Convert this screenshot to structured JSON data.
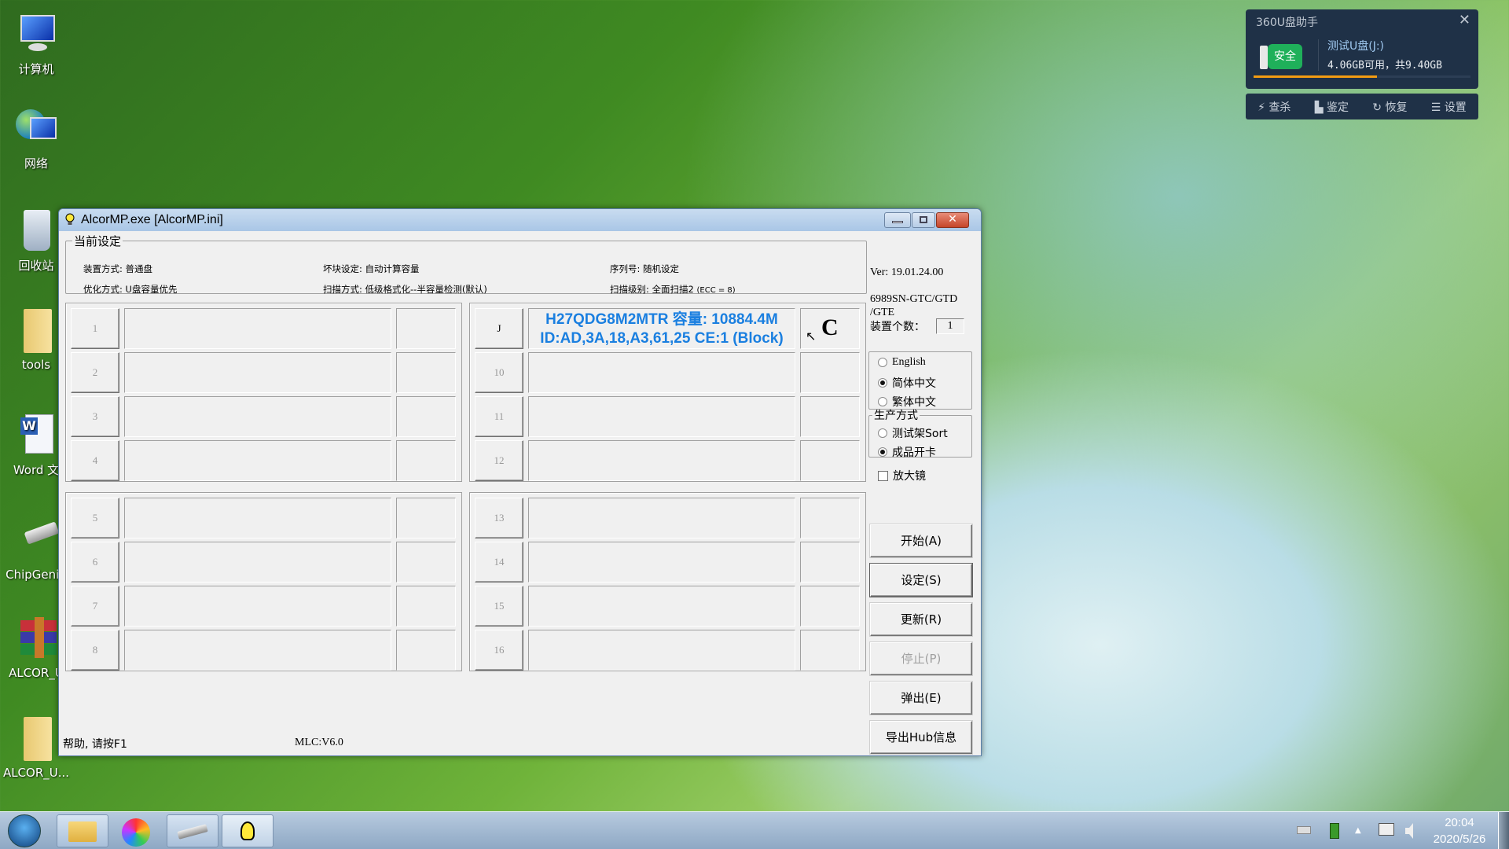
{
  "desktop": {
    "icons": [
      {
        "name": "computer",
        "label": "计算机"
      },
      {
        "name": "network",
        "label": "网络"
      },
      {
        "name": "recycle-bin",
        "label": "回收站"
      },
      {
        "name": "tools-folder",
        "label": "tools"
      },
      {
        "name": "word-document",
        "label": "Word 文"
      },
      {
        "name": "chipgenius",
        "label": "ChipGeniu"
      },
      {
        "name": "alcor-archive",
        "label": "ALCOR_U"
      },
      {
        "name": "alcor-folder",
        "label": "ALCOR_U..."
      }
    ]
  },
  "window": {
    "title": "AlcorMP.exe [AlcorMP.ini]",
    "settings": {
      "legend": "当前设定",
      "mount_mode": "装置方式: 普通盘",
      "optimize_mode": "优化方式: U盘容量优先",
      "bad_block": "坏块设定: 自动计算容量",
      "scan_mode": "扫描方式: 低级格式化--半容量检测(默认)",
      "serial": "序列号: 随机设定",
      "scan_level": "扫描级别: 全面扫描2",
      "scan_level_ecc": "(ECC = 8)"
    },
    "version": "Ver: 19.01.24.00",
    "chip": "6989SN-GTC/GTD /GTE",
    "device_count_label": "装置个数：",
    "device_count": "1",
    "ports_left_top": [
      "1",
      "2",
      "3",
      "4"
    ],
    "ports_left_bottom": [
      "5",
      "6",
      "7",
      "8"
    ],
    "ports_right_top": [
      "J",
      "10",
      "11",
      "12"
    ],
    "ports_right_bottom": [
      "13",
      "14",
      "15",
      "16"
    ],
    "active_port": {
      "line1": "H27QDG8M2MTR 容量: 10884.4M",
      "line2": "ID:AD,3A,18,A3,61,25 CE:1 (Block)",
      "status": "C"
    },
    "language": {
      "options": [
        "English",
        "简体中文",
        "繁体中文"
      ],
      "selected": "简体中文"
    },
    "production": {
      "legend": "生产方式",
      "options": [
        "测试架Sort",
        "成品开卡"
      ],
      "selected": "成品开卡"
    },
    "magnifier_label": "放大镜",
    "magnifier_checked": false,
    "buttons": {
      "start": "开始(A)",
      "settings": "设定(S)",
      "refresh": "更新(R)",
      "stop": "停止(P)",
      "eject": "弹出(E)",
      "export_hub": "导出Hub信息"
    },
    "status_help": "帮助, 请按F1",
    "status_mlc": "MLC:V6.0"
  },
  "popup_360": {
    "title": "360U盘助手",
    "badge": "安全",
    "drive_name": "测试U盘(J:)",
    "space": "4.06GB可用，共9.40GB",
    "used_fraction": 0.57,
    "actions": [
      "查杀",
      "鉴定",
      "恢复",
      "设置"
    ],
    "accent": "#f39c12"
  },
  "taskbar": {
    "time": "20:04",
    "date": "2020/5/26"
  }
}
